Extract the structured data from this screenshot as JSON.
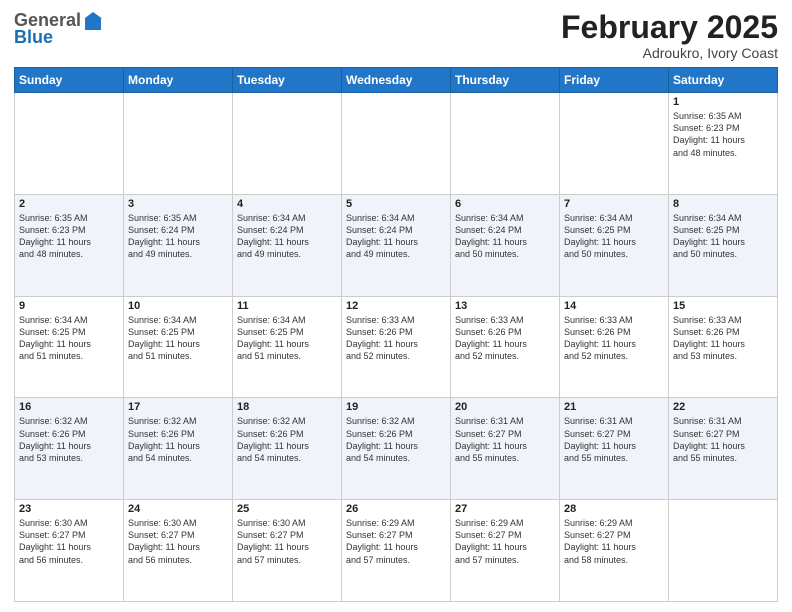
{
  "header": {
    "logo_general": "General",
    "logo_blue": "Blue",
    "month_title": "February 2025",
    "location": "Adroukro, Ivory Coast"
  },
  "days_of_week": [
    "Sunday",
    "Monday",
    "Tuesday",
    "Wednesday",
    "Thursday",
    "Friday",
    "Saturday"
  ],
  "weeks": [
    [
      {
        "day": "",
        "info": ""
      },
      {
        "day": "",
        "info": ""
      },
      {
        "day": "",
        "info": ""
      },
      {
        "day": "",
        "info": ""
      },
      {
        "day": "",
        "info": ""
      },
      {
        "day": "",
        "info": ""
      },
      {
        "day": "1",
        "info": "Sunrise: 6:35 AM\nSunset: 6:23 PM\nDaylight: 11 hours\nand 48 minutes."
      }
    ],
    [
      {
        "day": "2",
        "info": "Sunrise: 6:35 AM\nSunset: 6:23 PM\nDaylight: 11 hours\nand 48 minutes."
      },
      {
        "day": "3",
        "info": "Sunrise: 6:35 AM\nSunset: 6:24 PM\nDaylight: 11 hours\nand 49 minutes."
      },
      {
        "day": "4",
        "info": "Sunrise: 6:34 AM\nSunset: 6:24 PM\nDaylight: 11 hours\nand 49 minutes."
      },
      {
        "day": "5",
        "info": "Sunrise: 6:34 AM\nSunset: 6:24 PM\nDaylight: 11 hours\nand 49 minutes."
      },
      {
        "day": "6",
        "info": "Sunrise: 6:34 AM\nSunset: 6:24 PM\nDaylight: 11 hours\nand 50 minutes."
      },
      {
        "day": "7",
        "info": "Sunrise: 6:34 AM\nSunset: 6:25 PM\nDaylight: 11 hours\nand 50 minutes."
      },
      {
        "day": "8",
        "info": "Sunrise: 6:34 AM\nSunset: 6:25 PM\nDaylight: 11 hours\nand 50 minutes."
      }
    ],
    [
      {
        "day": "9",
        "info": "Sunrise: 6:34 AM\nSunset: 6:25 PM\nDaylight: 11 hours\nand 51 minutes."
      },
      {
        "day": "10",
        "info": "Sunrise: 6:34 AM\nSunset: 6:25 PM\nDaylight: 11 hours\nand 51 minutes."
      },
      {
        "day": "11",
        "info": "Sunrise: 6:34 AM\nSunset: 6:25 PM\nDaylight: 11 hours\nand 51 minutes."
      },
      {
        "day": "12",
        "info": "Sunrise: 6:33 AM\nSunset: 6:26 PM\nDaylight: 11 hours\nand 52 minutes."
      },
      {
        "day": "13",
        "info": "Sunrise: 6:33 AM\nSunset: 6:26 PM\nDaylight: 11 hours\nand 52 minutes."
      },
      {
        "day": "14",
        "info": "Sunrise: 6:33 AM\nSunset: 6:26 PM\nDaylight: 11 hours\nand 52 minutes."
      },
      {
        "day": "15",
        "info": "Sunrise: 6:33 AM\nSunset: 6:26 PM\nDaylight: 11 hours\nand 53 minutes."
      }
    ],
    [
      {
        "day": "16",
        "info": "Sunrise: 6:32 AM\nSunset: 6:26 PM\nDaylight: 11 hours\nand 53 minutes."
      },
      {
        "day": "17",
        "info": "Sunrise: 6:32 AM\nSunset: 6:26 PM\nDaylight: 11 hours\nand 54 minutes."
      },
      {
        "day": "18",
        "info": "Sunrise: 6:32 AM\nSunset: 6:26 PM\nDaylight: 11 hours\nand 54 minutes."
      },
      {
        "day": "19",
        "info": "Sunrise: 6:32 AM\nSunset: 6:26 PM\nDaylight: 11 hours\nand 54 minutes."
      },
      {
        "day": "20",
        "info": "Sunrise: 6:31 AM\nSunset: 6:27 PM\nDaylight: 11 hours\nand 55 minutes."
      },
      {
        "day": "21",
        "info": "Sunrise: 6:31 AM\nSunset: 6:27 PM\nDaylight: 11 hours\nand 55 minutes."
      },
      {
        "day": "22",
        "info": "Sunrise: 6:31 AM\nSunset: 6:27 PM\nDaylight: 11 hours\nand 55 minutes."
      }
    ],
    [
      {
        "day": "23",
        "info": "Sunrise: 6:30 AM\nSunset: 6:27 PM\nDaylight: 11 hours\nand 56 minutes."
      },
      {
        "day": "24",
        "info": "Sunrise: 6:30 AM\nSunset: 6:27 PM\nDaylight: 11 hours\nand 56 minutes."
      },
      {
        "day": "25",
        "info": "Sunrise: 6:30 AM\nSunset: 6:27 PM\nDaylight: 11 hours\nand 57 minutes."
      },
      {
        "day": "26",
        "info": "Sunrise: 6:29 AM\nSunset: 6:27 PM\nDaylight: 11 hours\nand 57 minutes."
      },
      {
        "day": "27",
        "info": "Sunrise: 6:29 AM\nSunset: 6:27 PM\nDaylight: 11 hours\nand 57 minutes."
      },
      {
        "day": "28",
        "info": "Sunrise: 6:29 AM\nSunset: 6:27 PM\nDaylight: 11 hours\nand 58 minutes."
      },
      {
        "day": "",
        "info": ""
      }
    ]
  ]
}
